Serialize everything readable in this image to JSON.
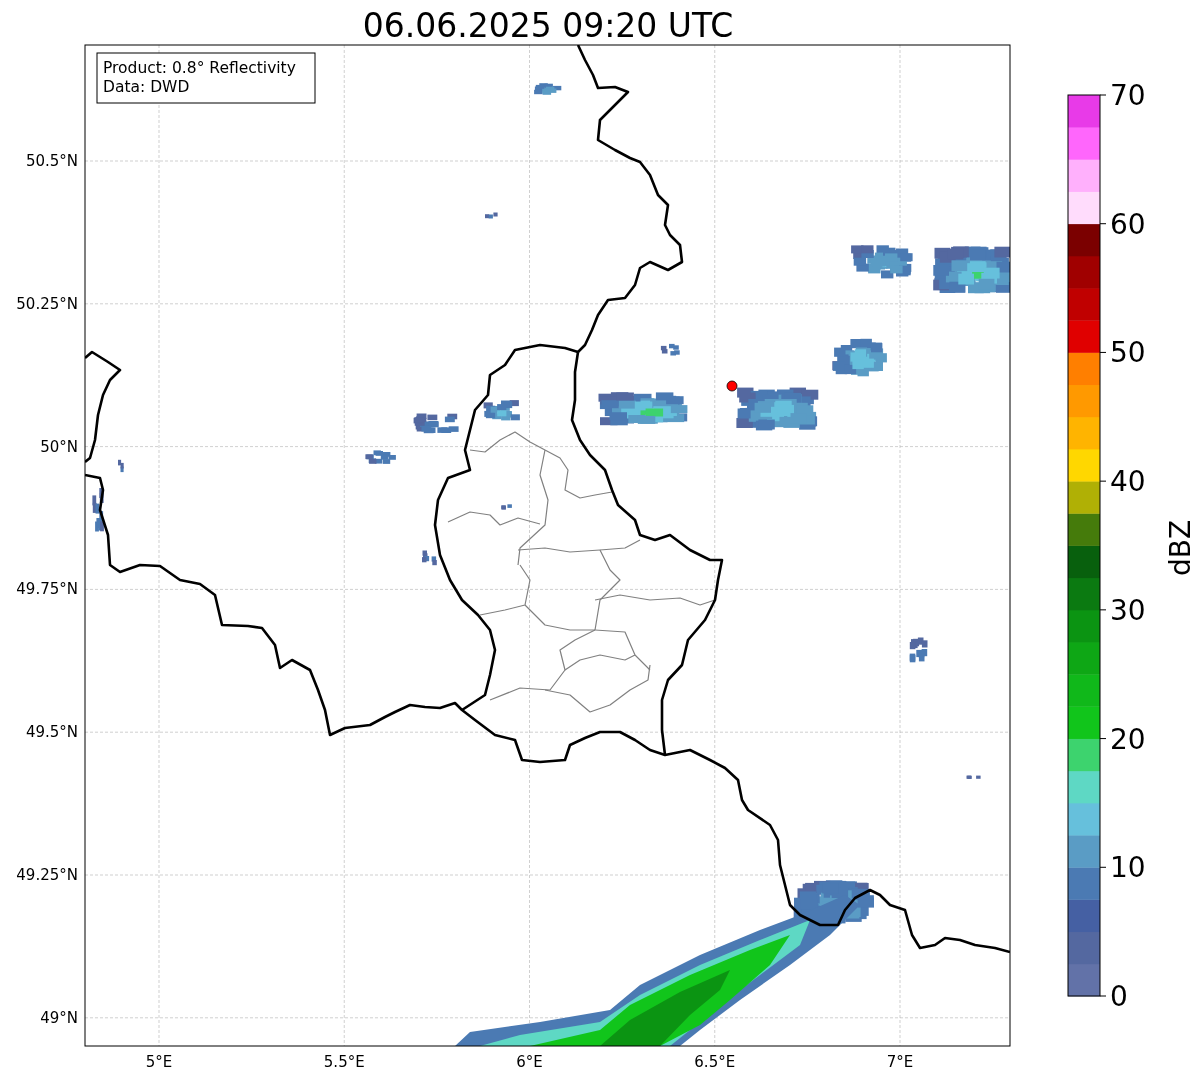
{
  "title": "06.06.2025 09:20 UTC",
  "info_box": {
    "lines": [
      "Product: 0.8° Reflectivity",
      "Data: DWD"
    ]
  },
  "map": {
    "xticks": [
      "5°E",
      "5.5°E",
      "6°E",
      "6.5°E",
      "7°E"
    ],
    "yticks": [
      "50.5°N",
      "50.25°N",
      "50°N",
      "49.75°N",
      "49.5°N",
      "49.25°N",
      "49°N"
    ]
  },
  "colorbar": {
    "label": "dBZ",
    "ticks": [
      "70",
      "60",
      "50",
      "40",
      "30",
      "20",
      "10",
      "0"
    ],
    "segments": [
      {
        "color": "#6272a8"
      },
      {
        "color": "#5468a0"
      },
      {
        "color": "#4560a3"
      },
      {
        "color": "#4b7ab3"
      },
      {
        "color": "#5a9cc5"
      },
      {
        "color": "#66c0dc"
      },
      {
        "color": "#5ed8c4"
      },
      {
        "color": "#3dd36e"
      },
      {
        "color": "#11c51b"
      },
      {
        "color": "#10b81a"
      },
      {
        "color": "#0ea715"
      },
      {
        "color": "#0b9412"
      },
      {
        "color": "#0b7a11"
      },
      {
        "color": "#08600d"
      },
      {
        "color": "#457b0b"
      },
      {
        "color": "#b0b005"
      },
      {
        "color": "#ffd700"
      },
      {
        "color": "#ffb400"
      },
      {
        "color": "#ff9900"
      },
      {
        "color": "#ff7f00"
      },
      {
        "color": "#e00000"
      },
      {
        "color": "#c00000"
      },
      {
        "color": "#a00000"
      },
      {
        "color": "#7b0000"
      },
      {
        "color": "#ffdcfc"
      },
      {
        "color": "#ffb0fc"
      },
      {
        "color": "#ff66fc"
      },
      {
        "color": "#e83ae8"
      }
    ]
  }
}
